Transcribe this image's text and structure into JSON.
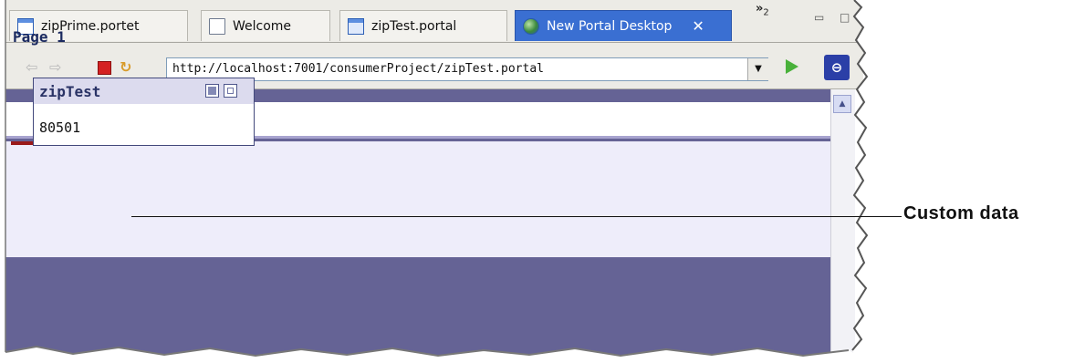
{
  "tabs": [
    {
      "label": "zipPrime.portet",
      "icon": "portlet-icon"
    },
    {
      "label": "Welcome",
      "icon": "document-icon"
    },
    {
      "label": "zipTest.portal",
      "icon": "portal-icon"
    },
    {
      "label": "New Portal Desktop",
      "icon": "globe-icon",
      "active": true
    }
  ],
  "overflow_label": "»",
  "overflow_count": "2",
  "address_bar": {
    "url": "http://localhost:7001/consumerProject/zipTest.portal"
  },
  "portal": {
    "page_tab": "Page 1",
    "portlet": {
      "title": "zipTest",
      "content": "80501"
    }
  },
  "callout": {
    "label": "Custom data"
  },
  "colors": {
    "active_tab": "#3a6fd2",
    "portal_bg": "#656395",
    "page_underline": "#9a1a1a"
  }
}
